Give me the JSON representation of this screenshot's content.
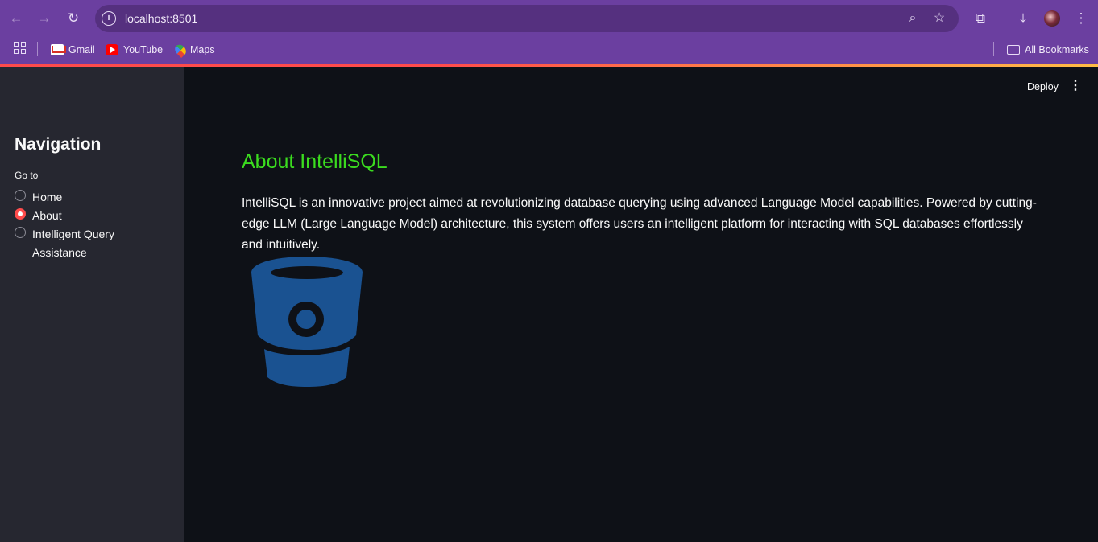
{
  "browser": {
    "url": "localhost:8501",
    "bookmarks": [
      {
        "label": "Gmail",
        "icon": "gmail-icon"
      },
      {
        "label": "YouTube",
        "icon": "youtube-icon"
      },
      {
        "label": "Maps",
        "icon": "maps-icon"
      }
    ],
    "all_bookmarks_label": "All Bookmarks",
    "theme_color": "#6b3fa0"
  },
  "header": {
    "deploy_label": "Deploy"
  },
  "sidebar": {
    "title": "Navigation",
    "radio_label": "Go to",
    "options": [
      "Home",
      "About",
      "Intelligent Query Assistance"
    ],
    "selected": "About"
  },
  "main": {
    "heading": "About IntelliSQL",
    "heading_color": "#3bdc1f",
    "paragraph": "IntelliSQL is an innovative project aimed at revolutionizing database querying using advanced Language Model capabilities. Powered by cutting-edge LLM (Large Language Model) architecture, this system offers users an intelligent platform for interacting with SQL databases effortlessly and intuitively.",
    "logo_icon": "bitbucket-logo",
    "logo_color": "#1a5291"
  },
  "accent_color": "#ff4b4b"
}
